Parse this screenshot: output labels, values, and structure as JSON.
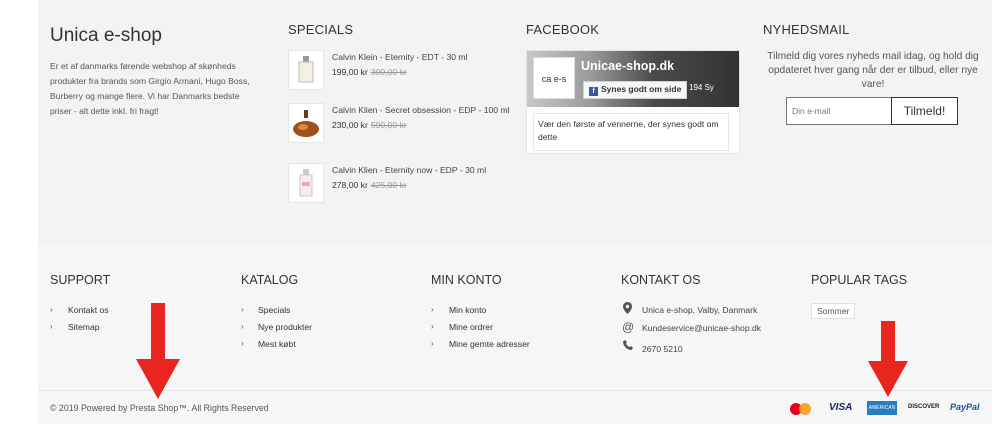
{
  "brand": {
    "title": "Unica e-shop",
    "description": "Er et af danmarks førende webshop af skønheds produkter fra brands som Girgio Armani, Hugo Boss, Burberry og mange flere. Vi har Danmarks bedste priser - alt dette inkl. fri fragt!"
  },
  "specials": {
    "heading": "SPECIALS",
    "items": [
      {
        "name": "Calvin Klein - Eternity - EDT - 30 ml",
        "price": "199,00 kr",
        "old_price": "300,00 kr"
      },
      {
        "name": "Calvin Klien - Secret obsession - EDP - 100 ml",
        "price": "230,00 kr",
        "old_price": "590,00 kr"
      },
      {
        "name": "Calvin Klien - Eternity now - EDP - 30 ml",
        "price": "278,00 kr",
        "old_price": "425,00 kr"
      }
    ]
  },
  "facebook": {
    "heading": "FACEBOOK",
    "page_name": "Unicae-shop.dk",
    "like_label": "Synes godt om side",
    "logo_text": "ca e-s",
    "count_text": "194 Sy",
    "friends_text": "Vær den første af vennerne, der synes godt om dette"
  },
  "newsletter": {
    "heading": "NYHEDSMAIL",
    "text": "Tilmeld dig vores nyheds mail idag, og hold dig opdateret hver gang når der er tilbud, eller nye vare!",
    "placeholder": "Din e-mail",
    "button_label": "Tilmeld!"
  },
  "support": {
    "heading": "SUPPORT",
    "links": [
      "Kontakt os",
      "Sitemap"
    ]
  },
  "katalog": {
    "heading": "KATALOG",
    "links": [
      "Specials",
      "Nye produkter",
      "Mest købt"
    ]
  },
  "min_konto": {
    "heading": "MIN KONTO",
    "links": [
      "Min konto",
      "Mine ordrer",
      "Mine gemte adresser"
    ]
  },
  "kontakt": {
    "heading": "KONTAKT OS",
    "address": "Unica e-shop, Valby, Danmark",
    "email": "Kundeservice@unicae-shop.dk",
    "phone": "2670 5210"
  },
  "tags": {
    "heading": "POPULAR TAGS",
    "items": [
      "Sommer"
    ]
  },
  "footer": {
    "copyright": "© 2019 Powered by Presta Shop™. All Rights Reserved",
    "payments": {
      "visa": "VISA",
      "amex": "AMERICAN EXPRESS",
      "discover": "DISCOVER",
      "paypal": "PayPal"
    }
  },
  "colors": {
    "arrow": "#e8261f",
    "facebook_blue": "#3b5998",
    "paypal_blue": "#1a4f9c",
    "visa_blue": "#1a1f71"
  }
}
